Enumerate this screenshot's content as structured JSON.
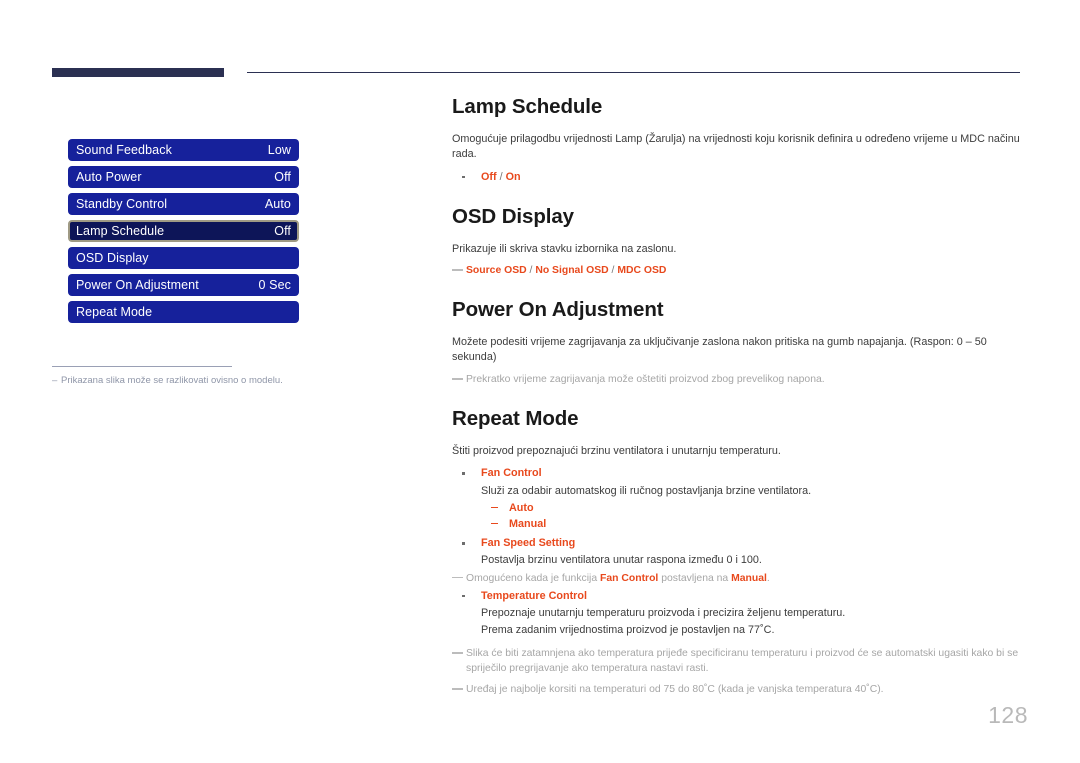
{
  "header": {
    "left_bar": "",
    "right_rule": ""
  },
  "osd_menu": {
    "rows": [
      {
        "label": "Sound Feedback",
        "value": "Low",
        "selected": false
      },
      {
        "label": "Auto Power",
        "value": "Off",
        "selected": false
      },
      {
        "label": "Standby Control",
        "value": "Auto",
        "selected": false
      },
      {
        "label": "Lamp Schedule",
        "value": "Off",
        "selected": true
      },
      {
        "label": "OSD Display",
        "value": "",
        "selected": false
      },
      {
        "label": "Power On Adjustment",
        "value": "0 Sec",
        "selected": false
      },
      {
        "label": "Repeat Mode",
        "value": "",
        "selected": false
      }
    ],
    "footnote": "Prikazana slika može se razlikovati ovisno o modelu."
  },
  "sections": {
    "lamp_schedule": {
      "title": "Lamp Schedule",
      "body": "Omogućuje prilagodbu vrijednosti Lamp (Žarulja) na vrijednosti koju korisnik definira u određeno vrijeme u MDC načinu rada.",
      "option_off": "Off",
      "option_sep": " / ",
      "option_on": "On"
    },
    "osd_display": {
      "title": "OSD Display",
      "body": "Prikazuje ili skriva stavku izbornika na zaslonu.",
      "opt1": "Source OSD",
      "sep1": " / ",
      "opt2": "No Signal OSD",
      "sep2": " / ",
      "opt3": "MDC OSD"
    },
    "power_on_adjustment": {
      "title": "Power On Adjustment",
      "body": "Možete podesiti vrijeme zagrijavanja za uključivanje zaslona nakon pritiska na gumb napajanja. (Raspon: 0 – 50 sekunda)",
      "note": "Prekratko vrijeme zagrijavanja može oštetiti proizvod zbog prevelikog napona."
    },
    "repeat_mode": {
      "title": "Repeat Mode",
      "body": "Štiti proizvod prepoznajući brzinu ventilatora i unutarnju temperaturu.",
      "fan_control": {
        "label": "Fan Control",
        "desc": "Služi za odabir automatskog ili ručnog postavljanja brzine ventilatora.",
        "options": [
          "Auto",
          "Manual"
        ]
      },
      "fan_speed_setting": {
        "label": "Fan Speed Setting",
        "desc": "Postavlja brzinu ventilatora unutar raspona između 0 i 100."
      },
      "fan_note_pre": "Omogućeno kada je funkcija ",
      "fan_note_term1": "Fan Control",
      "fan_note_mid": " postavljena na ",
      "fan_note_term2": "Manual",
      "fan_note_post": ".",
      "temperature_control": {
        "label": "Temperature Control",
        "desc1": "Prepoznaje unutarnju temperaturu proizvoda i precizira željenu temperaturu.",
        "desc2": "Prema zadanim vrijednostima proizvod je postavljen na 77˚C."
      },
      "note1": "Slika će biti zatamnjena ako temperatura prijeđe specificiranu temperaturu i proizvod će se automatski ugasiti  kako bi se spriječilo pregrijavanje ako temperatura nastavi rasti.",
      "note2": "Uređaj je najbolje korsiti na temperaturi od 75 do 80˚C (kada je vanjska temperatura 40˚C)."
    }
  },
  "page": {
    "number": "128"
  },
  "colors": {
    "menu_blue": "#16219b",
    "menu_blue_selected": "#0d1558",
    "selected_border": "#9f9a84",
    "accent_orange": "#e8491d",
    "header_navy": "#2b3052",
    "note_gray": "#a6a6a6"
  }
}
